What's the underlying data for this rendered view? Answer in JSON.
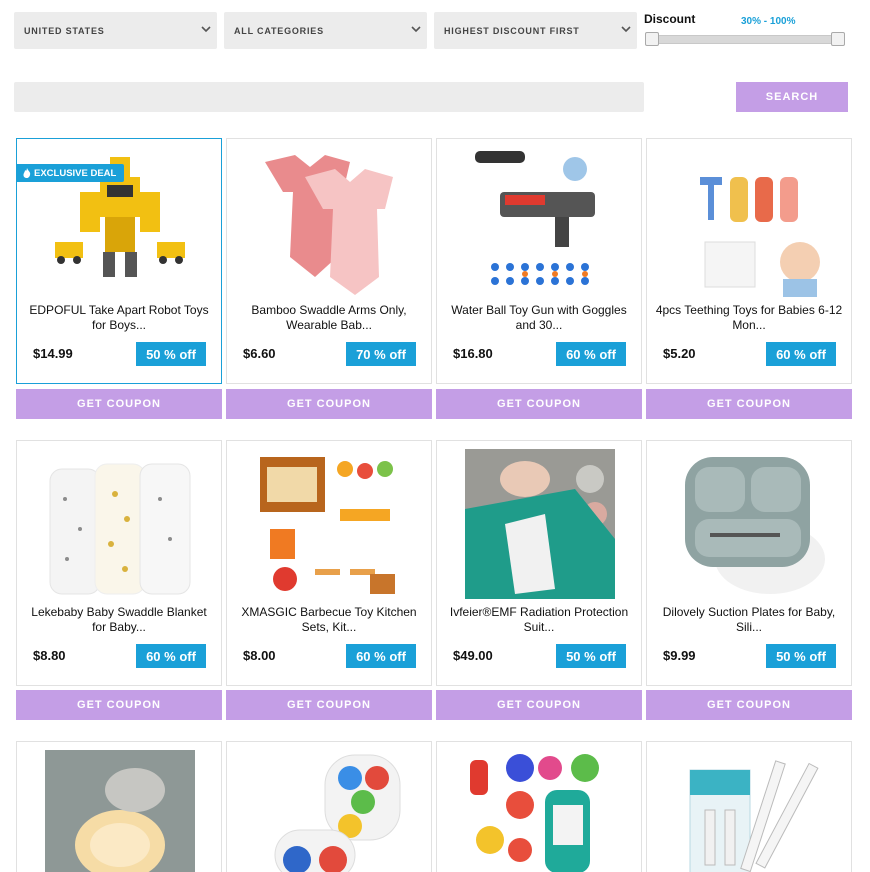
{
  "filters": {
    "country": "UNITED STATES",
    "category": "ALL CATEGORIES",
    "sort": "HIGHEST DISCOUNT FIRST",
    "discount_label": "Discount",
    "discount_range_text": "30% - 100%",
    "discount_min_pct": 30,
    "discount_max_pct": 100
  },
  "search": {
    "placeholder": "",
    "value": "",
    "button_label": "SEARCH"
  },
  "products": [
    {
      "title": "EDPOFUL Take Apart Robot Toys for Boys...",
      "price": "$14.99",
      "discount": "50 % off",
      "badge": "EXCLUSIVE DEAL",
      "coupon_label": "GET COUPON",
      "image": "robot-toy-image"
    },
    {
      "title": "Bamboo Swaddle Arms Only, Wearable Bab...",
      "price": "$6.60",
      "discount": "70 % off",
      "coupon_label": "GET COUPON",
      "image": "baby-bodysuit-image"
    },
    {
      "title": "Water Ball Toy Gun with Goggles and 30...",
      "price": "$16.80",
      "discount": "60 % off",
      "coupon_label": "GET COUPON",
      "image": "toy-gun-image"
    },
    {
      "title": "4pcs Teething Toys for Babies 6-12 Mon...",
      "price": "$5.20",
      "discount": "60 % off",
      "coupon_label": "GET COUPON",
      "image": "teething-toys-image"
    },
    {
      "title": "Lekebaby Baby Swaddle Blanket for Baby...",
      "price": "$8.80",
      "discount": "60 % off",
      "coupon_label": "GET COUPON",
      "image": "swaddle-blanket-image"
    },
    {
      "title": "XMASGIC Barbecue Toy Kitchen Sets, Kit...",
      "price": "$8.00",
      "discount": "60 % off",
      "coupon_label": "GET COUPON",
      "image": "toy-kitchen-image"
    },
    {
      "title": "Ivfeier®EMF Radiation Protection Suit...",
      "price": "$49.00",
      "discount": "50 % off",
      "coupon_label": "GET COUPON",
      "image": "baby-blanket-photo"
    },
    {
      "title": "Dilovely Suction Plates for Baby, Sili...",
      "price": "$9.99",
      "discount": "50 % off",
      "coupon_label": "GET COUPON",
      "image": "suction-plate-image"
    },
    {
      "image": "night-light-image"
    },
    {
      "image": "pop-fidget-image"
    },
    {
      "image": "baby-rattles-image"
    },
    {
      "image": "nasal-syringe-image"
    }
  ],
  "colors": {
    "accent_blue": "#1aa0d8",
    "button_purple": "#c49ee6",
    "field_gray": "#ececec"
  }
}
